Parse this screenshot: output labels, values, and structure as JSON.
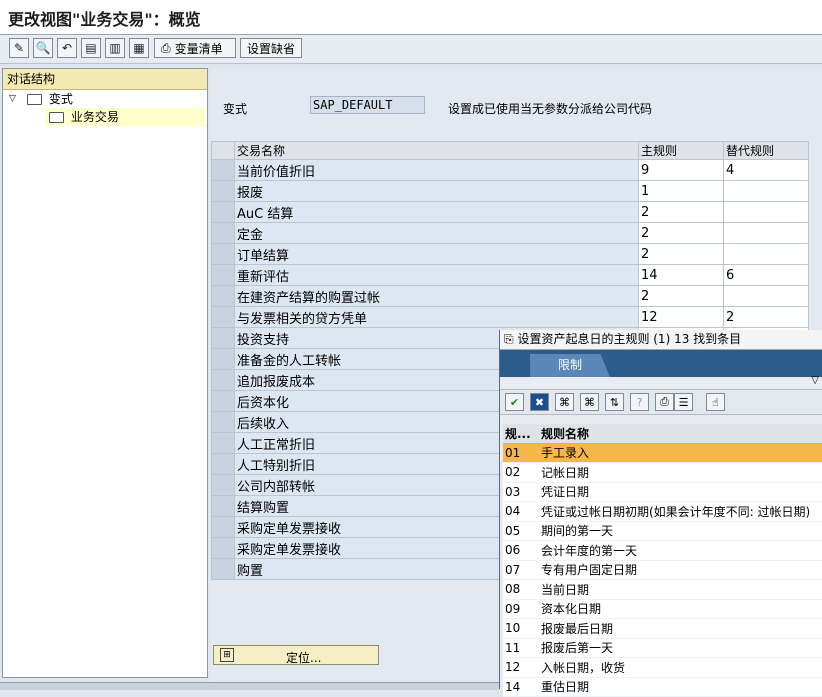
{
  "window": {
    "title": "更改视图\"业务交易\"：概览"
  },
  "toolbar": {
    "variant_list_label": "变量清单",
    "set_default_label": "设置缺省"
  },
  "tree": {
    "header": "对话结构",
    "items": [
      {
        "label": "变式"
      },
      {
        "label": "业务交易"
      }
    ]
  },
  "variant": {
    "label": "变式",
    "value": "SAP_DEFAULT",
    "description": "设置成已使用当无参数分派给公司代码"
  },
  "table": {
    "headers": {
      "name": "交易名称",
      "main_rule": "主规则",
      "alt_rule": "替代规则"
    },
    "rows": [
      {
        "name": "当前价值折旧",
        "main": "9",
        "alt": "4"
      },
      {
        "name": "报废",
        "main": "1",
        "alt": ""
      },
      {
        "name": "AuC 结算",
        "main": "2",
        "alt": ""
      },
      {
        "name": "定金",
        "main": "2",
        "alt": ""
      },
      {
        "name": "订单结算",
        "main": "2",
        "alt": ""
      },
      {
        "name": "重新评估",
        "main": "14",
        "alt": "6"
      },
      {
        "name": "在建资产结算的购置过帐",
        "main": "2",
        "alt": ""
      },
      {
        "name": "与发票相关的贷方凭单",
        "main": "12",
        "alt": "2"
      },
      {
        "name": "投资支持",
        "main": "",
        "alt": ""
      },
      {
        "name": "准备金的人工转帐",
        "main": "",
        "alt": ""
      },
      {
        "name": "追加报废成本",
        "main": "",
        "alt": ""
      },
      {
        "name": "后资本化",
        "main": "",
        "alt": ""
      },
      {
        "name": "后续收入",
        "main": "",
        "alt": ""
      },
      {
        "name": "人工正常折旧",
        "main": "",
        "alt": ""
      },
      {
        "name": "人工特别折旧",
        "main": "",
        "alt": ""
      },
      {
        "name": "公司内部转帐",
        "main": "",
        "alt": ""
      },
      {
        "name": "结算购置",
        "main": "",
        "alt": ""
      },
      {
        "name": "采购定单发票接收",
        "main": "",
        "alt": ""
      },
      {
        "name": "采购定单发票接收",
        "main": "",
        "alt": ""
      },
      {
        "name": "购置",
        "main": "",
        "alt": ""
      }
    ]
  },
  "locate_button": {
    "label": "定位..."
  },
  "popup": {
    "title": "设置资产起息日的主规则 (1)   13 找到条目",
    "tab": "限制",
    "col1": "规...",
    "col2": "规则名称",
    "rows": [
      {
        "code": "01",
        "name": "手工录入"
      },
      {
        "code": "02",
        "name": "记帐日期"
      },
      {
        "code": "03",
        "name": "凭证日期"
      },
      {
        "code": "04",
        "name": "凭证或过帐日期初期(如果会计年度不同: 过帐日期)"
      },
      {
        "code": "05",
        "name": "期间的第一天"
      },
      {
        "code": "06",
        "name": "会计年度的第一天"
      },
      {
        "code": "07",
        "name": "专有用户固定日期"
      },
      {
        "code": "08",
        "name": "当前日期"
      },
      {
        "code": "09",
        "name": "资本化日期"
      },
      {
        "code": "10",
        "name": "报废最后日期"
      },
      {
        "code": "11",
        "name": "报废后第一天"
      },
      {
        "code": "12",
        "name": "入帐日期，收货"
      },
      {
        "code": "14",
        "name": "重估日期"
      }
    ]
  }
}
